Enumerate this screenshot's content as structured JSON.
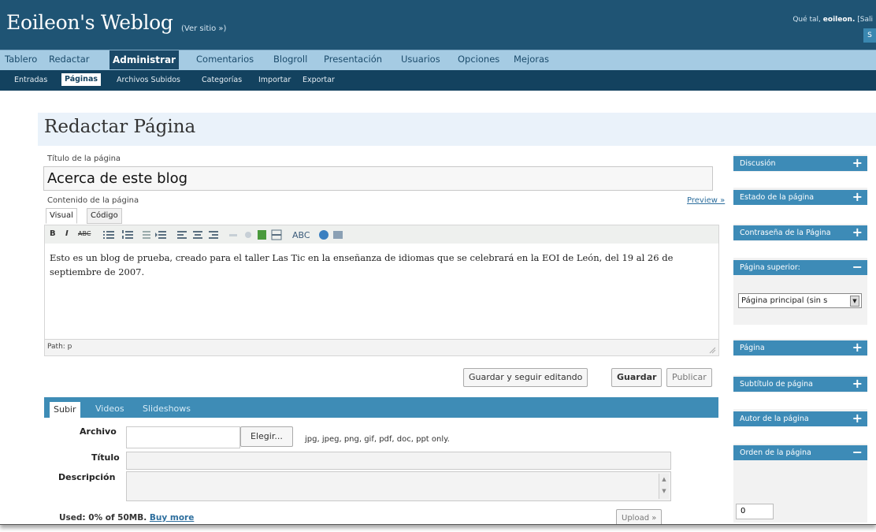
{
  "header": {
    "site_title": "Eoileon's Weblog",
    "view_site": "(Ver sitio »)",
    "greeting_prefix": "Qué tal,",
    "username": "eoileon.",
    "greeting_suffix": "[Sali",
    "corner_button": "S"
  },
  "main_menu": [
    "Tablero",
    "Redactar",
    "Administrar",
    "Comentarios",
    "Blogroll",
    "Presentación",
    "Usuarios",
    "Opciones",
    "Mejoras"
  ],
  "sub_menu": [
    "Entradas",
    "Páginas",
    "Archivos Subidos",
    "Categorías",
    "Importar",
    "Exportar"
  ],
  "page": {
    "heading": "Redactar Página",
    "title_label": "Título de la página",
    "title_value": "Acerca de este blog",
    "content_label": "Contenido de la página",
    "preview_link": "Preview »",
    "tabs": [
      "Visual",
      "Código"
    ],
    "toolbar": [
      "B",
      "I",
      "ABC"
    ],
    "content_text": "Esto es un blog de prueba, creado para el taller Las Tic en la enseñanza de idiomas que se celebrará en la EOI de León, del 19 al 26 de septiembre de 2007.",
    "path": "Path: p",
    "buttons": {
      "save_continue": "Guardar y seguir editando",
      "save": "Guardar",
      "publish": "Publicar"
    }
  },
  "uploader": {
    "tabs": [
      "Subir",
      "Videos",
      "Slideshows"
    ],
    "file_label": "Archivo",
    "choose_button": "Elegir...",
    "allowed_types": "jpg, jpeg, png, gif, pdf, doc, ppt only.",
    "title_label": "Título",
    "description_label": "Descripción",
    "used_text": "Used: 0% of 50MB.",
    "buy_more": "Buy more",
    "upload_button": "Upload »"
  },
  "sidebar": {
    "boxes": [
      {
        "label": "Discusión",
        "sign": "+"
      },
      {
        "label": "Estado de la página",
        "sign": "+"
      },
      {
        "label": "Contraseña de la Página",
        "sign": "+"
      },
      {
        "label": "Página superior:",
        "sign": "−"
      },
      {
        "label": "Página",
        "sign": "+"
      },
      {
        "label": "Subtítulo de página",
        "sign": "+"
      },
      {
        "label": "Autor de la página",
        "sign": "+"
      },
      {
        "label": "Orden de la página",
        "sign": "−"
      }
    ],
    "parent_select": "Página principal (sin s",
    "order_value": "0"
  },
  "colors": {
    "header": "#1f5474",
    "menu": "#a5cbe3",
    "submenu": "#13425f",
    "accent": "#3d8bb7"
  }
}
